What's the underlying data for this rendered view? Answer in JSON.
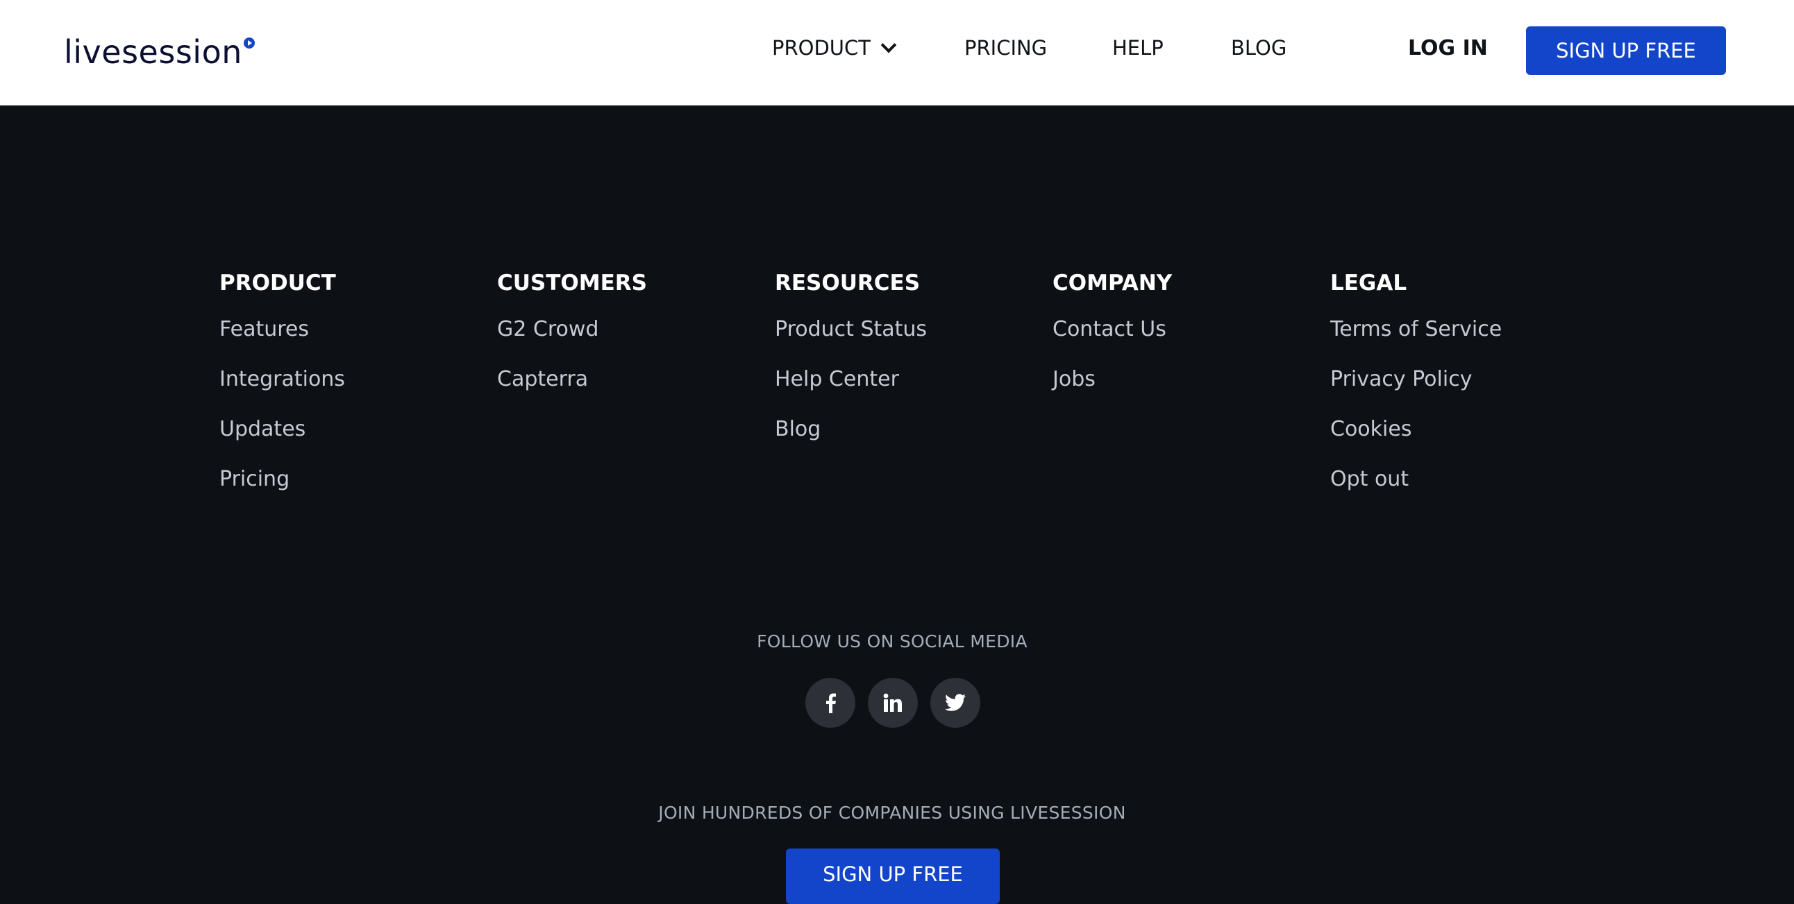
{
  "header": {
    "logo_text": "livesession",
    "nav": {
      "product": "PRODUCT",
      "pricing": "PRICING",
      "help": "HELP",
      "blog": "BLOG"
    },
    "login": "LOG IN",
    "signup": "SIGN UP FREE"
  },
  "footer": {
    "columns": [
      {
        "title": "PRODUCT",
        "links": [
          "Features",
          "Integrations",
          "Updates",
          "Pricing"
        ]
      },
      {
        "title": "CUSTOMERS",
        "links": [
          "G2 Crowd",
          "Capterra"
        ]
      },
      {
        "title": "RESOURCES",
        "links": [
          "Product Status",
          "Help Center",
          "Blog"
        ]
      },
      {
        "title": "COMPANY",
        "links": [
          "Contact Us",
          "Jobs"
        ]
      },
      {
        "title": "LEGAL",
        "links": [
          "Terms of Service",
          "Privacy Policy",
          "Cookies",
          "Opt out"
        ]
      }
    ],
    "follow_text": "FOLLOW US ON SOCIAL MEDIA",
    "socials": [
      "facebook-icon",
      "linkedin-icon",
      "twitter-icon"
    ],
    "join_text": "JOIN HUNDREDS OF COMPANIES USING LIVESESSION",
    "signup": "SIGN UP FREE"
  },
  "colors": {
    "accent": "#1245c9",
    "footer_bg": "#0d1014",
    "header_bg": "#ffffff"
  }
}
